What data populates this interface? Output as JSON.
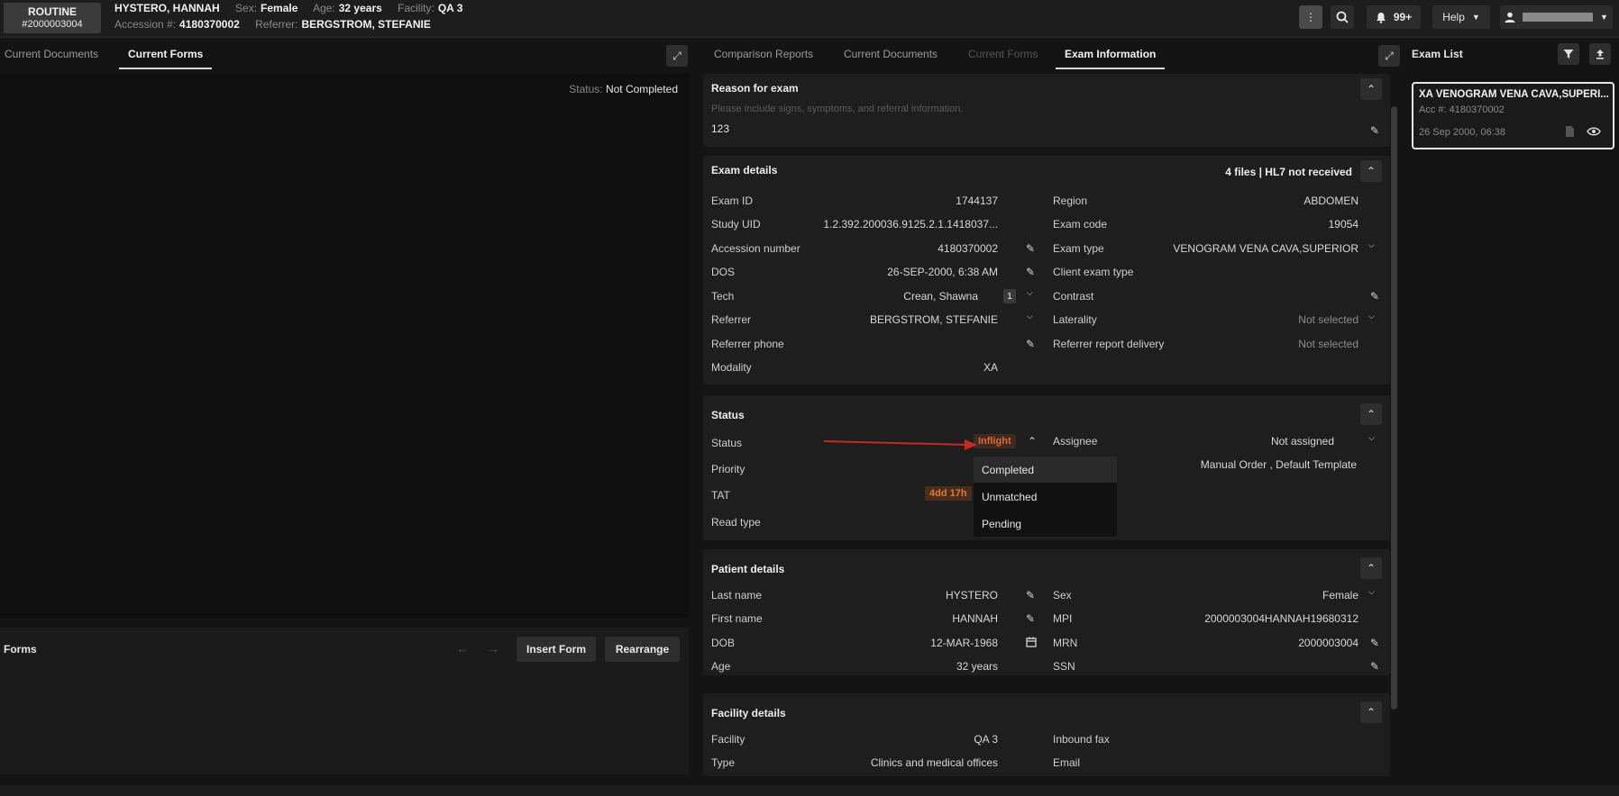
{
  "header": {
    "priority": "ROUTINE",
    "order_number": "#2000003004",
    "patient_name": "HYSTERO, HANNAH",
    "sex_label": "Sex:",
    "sex": "Female",
    "age_label": "Age:",
    "age": "32 years",
    "facility_label": "Facility:",
    "facility": "QA 3",
    "accession_label": "Accession #:",
    "accession": "4180370002",
    "referrer_label": "Referrer:",
    "referrer": "BERGSTROM, STEFANIE",
    "notifications": "99+",
    "help": "Help"
  },
  "left": {
    "tabs": [
      "Current Documents",
      "Current Forms"
    ],
    "status_label": "Status:",
    "status_value": "Not Completed",
    "forms_title": "Forms",
    "insert_form": "Insert Form",
    "rearrange": "Rearrange"
  },
  "middle": {
    "tabs": [
      "Comparison Reports",
      "Current Documents",
      "Current Forms",
      "Exam Information"
    ],
    "reason": {
      "title": "Reason for exam",
      "placeholder": "Please include signs, symptoms, and referral information.",
      "value": "123"
    },
    "exam_details": {
      "title": "Exam details",
      "files_info": "4 files | HL7 not received",
      "left": [
        {
          "label": "Exam ID",
          "value": "1744137"
        },
        {
          "label": "Study UID",
          "value": "1.2.392.200036.9125.2.1.1418037..."
        },
        {
          "label": "Accession number",
          "value": "4180370002"
        },
        {
          "label": "DOS",
          "value": "26-SEP-2000, 6:38 AM"
        },
        {
          "label": "Tech",
          "value": "Crean, Shawna",
          "badge": "1"
        },
        {
          "label": "Referrer",
          "value": "BERGSTROM, STEFANIE"
        },
        {
          "label": "Referrer phone",
          "value": ""
        },
        {
          "label": "Modality",
          "value": "XA"
        }
      ],
      "right": [
        {
          "label": "Region",
          "value": "ABDOMEN"
        },
        {
          "label": "Exam code",
          "value": "19054"
        },
        {
          "label": "Exam type",
          "value": "VENOGRAM VENA CAVA,SUPERIOR"
        },
        {
          "label": "Client exam type",
          "value": ""
        },
        {
          "label": "Contrast",
          "value": ""
        },
        {
          "label": "Laterality",
          "value": "Not selected"
        },
        {
          "label": "Referrer report delivery",
          "value": "Not selected"
        }
      ]
    },
    "status": {
      "title": "Status",
      "status_label": "Status",
      "status_value": "Inflight",
      "priority_label": "Priority",
      "tat_label": "TAT",
      "tat_value": "4dd 17h",
      "read_type_label": "Read type",
      "assignee_label": "Assignee",
      "assignee_value": "Not assigned",
      "template_value": "Manual Order , Default Template",
      "menu": [
        "Completed",
        "Unmatched",
        "Pending"
      ]
    },
    "patient": {
      "title": "Patient details",
      "left": [
        {
          "label": "Last name",
          "value": "HYSTERO"
        },
        {
          "label": "First name",
          "value": "HANNAH"
        },
        {
          "label": "DOB",
          "value": "12-MAR-1968"
        },
        {
          "label": "Age",
          "value": "32 years"
        }
      ],
      "right": [
        {
          "label": "Sex",
          "value": "Female"
        },
        {
          "label": "MPI",
          "value": "2000003004HANNAH19680312"
        },
        {
          "label": "MRN",
          "value": "2000003004"
        },
        {
          "label": "SSN",
          "value": ""
        }
      ]
    },
    "facility": {
      "title": "Facility details",
      "left": [
        {
          "label": "Facility",
          "value": "QA 3"
        },
        {
          "label": "Type",
          "value": "Clinics and medical offices"
        }
      ],
      "right": [
        {
          "label": "Inbound fax",
          "value": ""
        },
        {
          "label": "Email",
          "value": ""
        }
      ]
    }
  },
  "right": {
    "title": "Exam List",
    "exam": {
      "title": "XA VENOGRAM VENA CAVA,SUPERI...",
      "acc": "Acc #: 4180370002",
      "date": "26 Sep 2000, 06:38"
    }
  },
  "colors": {
    "accent_orange": "#e06a2c",
    "annotation_red": "#c62a22"
  }
}
